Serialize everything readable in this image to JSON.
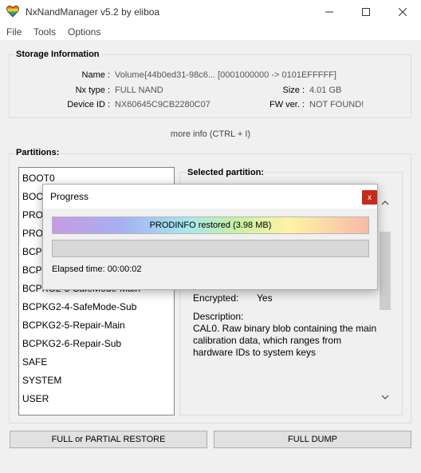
{
  "window": {
    "title": "NxNandManager v5.2 by eliboa"
  },
  "menu": [
    "File",
    "Tools",
    "Options"
  ],
  "storage": {
    "title": "Storage Information",
    "name_label": "Name :",
    "name_value": "Volume{44b0ed31-98c6... [0001000000 -> 0101EFFFFF]",
    "nxtype_label": "Nx type :",
    "nxtype_value": "FULL NAND",
    "size_label": "Size :",
    "size_value": "4.01 GB",
    "deviceid_label": "Device ID :",
    "deviceid_value": "NX60645C9CB2280C07",
    "fwver_label": "FW ver. :",
    "fwver_value": "NOT FOUND!"
  },
  "more_info": "more info (CTRL + I)",
  "partitions": {
    "title": "Partitions:",
    "items": [
      "BOOT0",
      "BOOT1",
      "PRODINFO",
      "PRODINFOF",
      "BCPKG2-1-Normal-Main",
      "BCPKG2-2-Normal-Sub",
      "BCPKG2-3-SafeMode-Main",
      "BCPKG2-4-SafeMode-Sub",
      "BCPKG2-5-Repair-Main",
      "BCPKG2-6-Repair-Sub",
      "SAFE",
      "SYSTEM",
      "USER"
    ]
  },
  "selected": {
    "title": "Selected partition:",
    "encrypted_label": "Encrypted:",
    "encrypted_value": "Yes",
    "description_label": "Description:",
    "description_lines": [
      "CAL0. Raw binary blob containing the main",
      "calibration data, which ranges from",
      "hardware IDs to system keys"
    ]
  },
  "buttons": {
    "restore": "FULL or PARTIAL RESTORE",
    "dump": "FULL DUMP"
  },
  "dialog": {
    "title": "Progress",
    "close": "x",
    "progress1_text": "PRODINFO restored (3.98 MB)",
    "progress1_value": 1.0,
    "progress2_value": 0,
    "elapsed": "Elapsed time: 00:00:02"
  }
}
